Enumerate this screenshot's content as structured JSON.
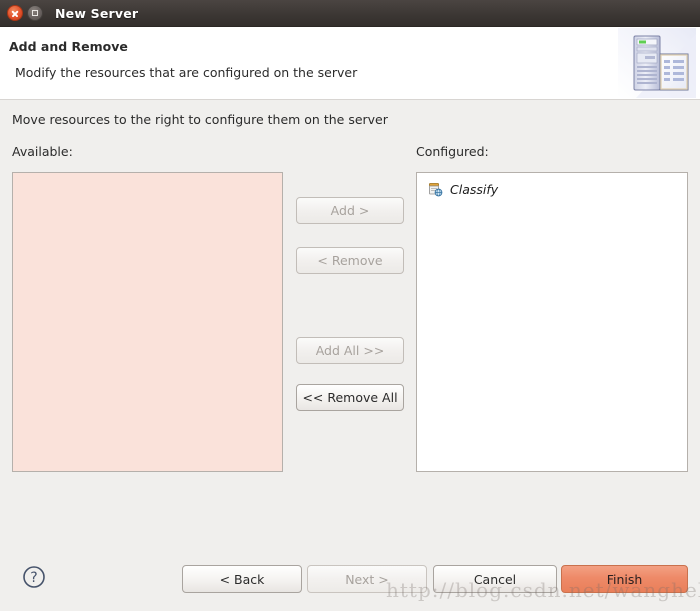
{
  "window": {
    "title": "New Server",
    "close_icon": "close-icon",
    "maximize_icon": "maximize-icon"
  },
  "header": {
    "title": "Add and Remove",
    "description": "Modify the resources that are configured on the server",
    "icon": "server-and-document-icon"
  },
  "body": {
    "intro": "Move resources to the right to configure them on the server",
    "available_label": "Available:",
    "configured_label": "Configured:",
    "available_items": [],
    "configured_items": [
      {
        "label": "Classify",
        "icon": "web-module-icon"
      }
    ]
  },
  "transfer_buttons": [
    {
      "id": "add",
      "label": "Add >",
      "enabled": false
    },
    {
      "id": "remove",
      "label": "< Remove",
      "enabled": false
    },
    {
      "id": "add-all",
      "label": "Add All >>",
      "enabled": false
    },
    {
      "id": "remove-all",
      "label": "<< Remove All",
      "enabled": true
    }
  ],
  "footer": {
    "help_icon": "help-icon",
    "buttons": [
      {
        "id": "back",
        "label": "< Back",
        "enabled": true,
        "primary": false
      },
      {
        "id": "next",
        "label": "Next >",
        "enabled": false,
        "primary": false
      },
      {
        "id": "cancel",
        "label": "Cancel",
        "enabled": true,
        "primary": false
      },
      {
        "id": "finish",
        "label": "Finish",
        "enabled": true,
        "primary": true
      }
    ]
  },
  "watermark": "http://blog.csdn.net/wanghello",
  "colors": {
    "titlebar": "#3c3734",
    "available_list_bg": "#fae2da",
    "configured_list_bg": "#ffffff",
    "finish_button": "#ee8a68",
    "dialog_bg": "#f0efed"
  }
}
